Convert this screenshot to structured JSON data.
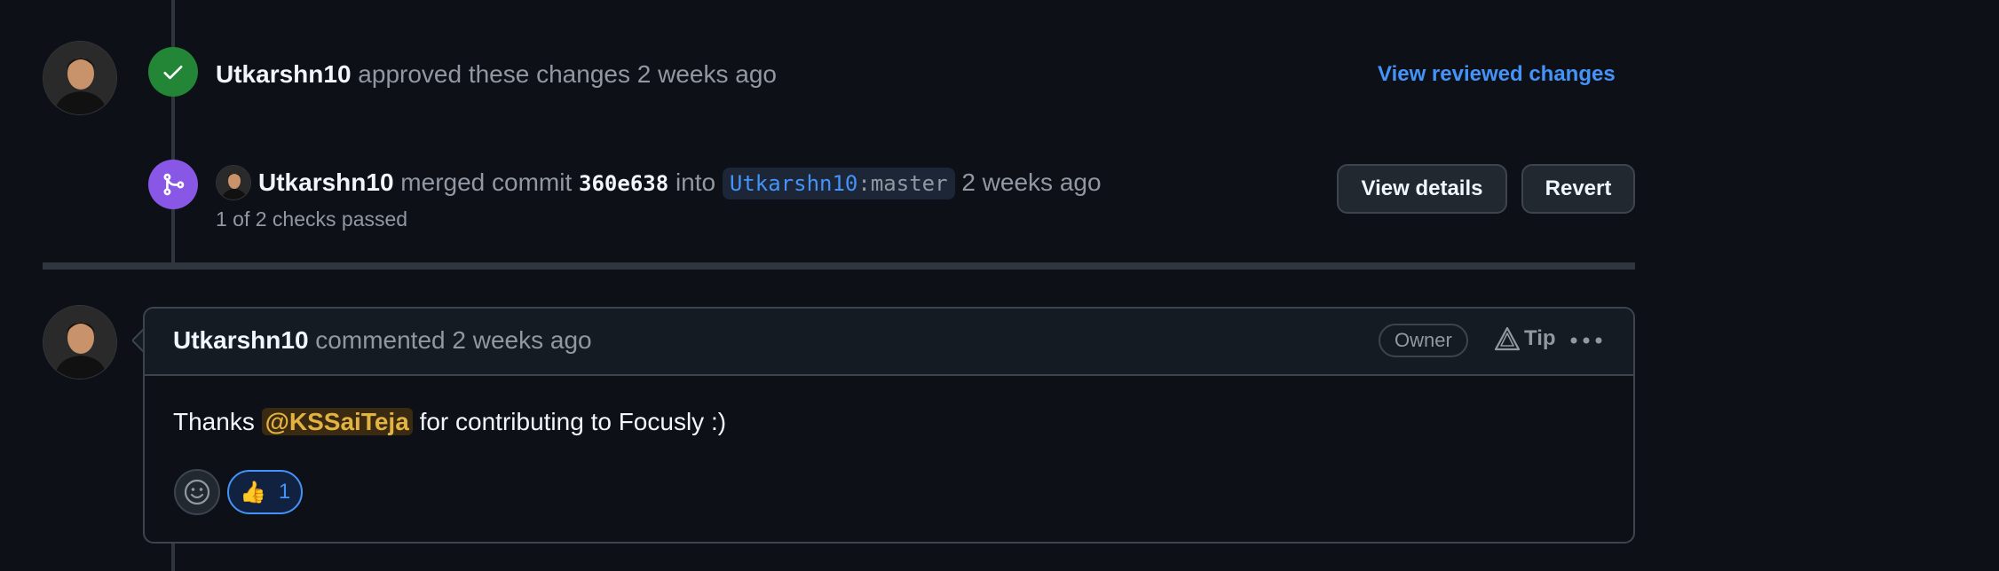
{
  "review": {
    "user": "Utkarshn10",
    "action": "approved these changes",
    "time": "2 weeks ago",
    "link": "View reviewed changes",
    "status_color": "#238636",
    "icon": "check-icon"
  },
  "merge": {
    "user": "Utkarshn10",
    "action": "merged commit",
    "commit": "360e638",
    "into": "into",
    "branch_user": "Utkarshn10",
    "branch_sep": ":",
    "branch_name": "master",
    "time": "2 weeks ago",
    "checks": "1 of 2 checks passed",
    "view_details_label": "View details",
    "revert_label": "Revert",
    "status_color": "#8957e5",
    "icon": "git-merge-icon"
  },
  "comment": {
    "user": "Utkarshn10",
    "action": "commented",
    "time": "2 weeks ago",
    "owner_label": "Owner",
    "tip_label": "Tip",
    "body_prefix": "Thanks",
    "mention": "@KSSaiTeja",
    "body_suffix": "for contributing to Focusly :)",
    "reaction_emoji": "👍",
    "reaction_count": "1"
  }
}
